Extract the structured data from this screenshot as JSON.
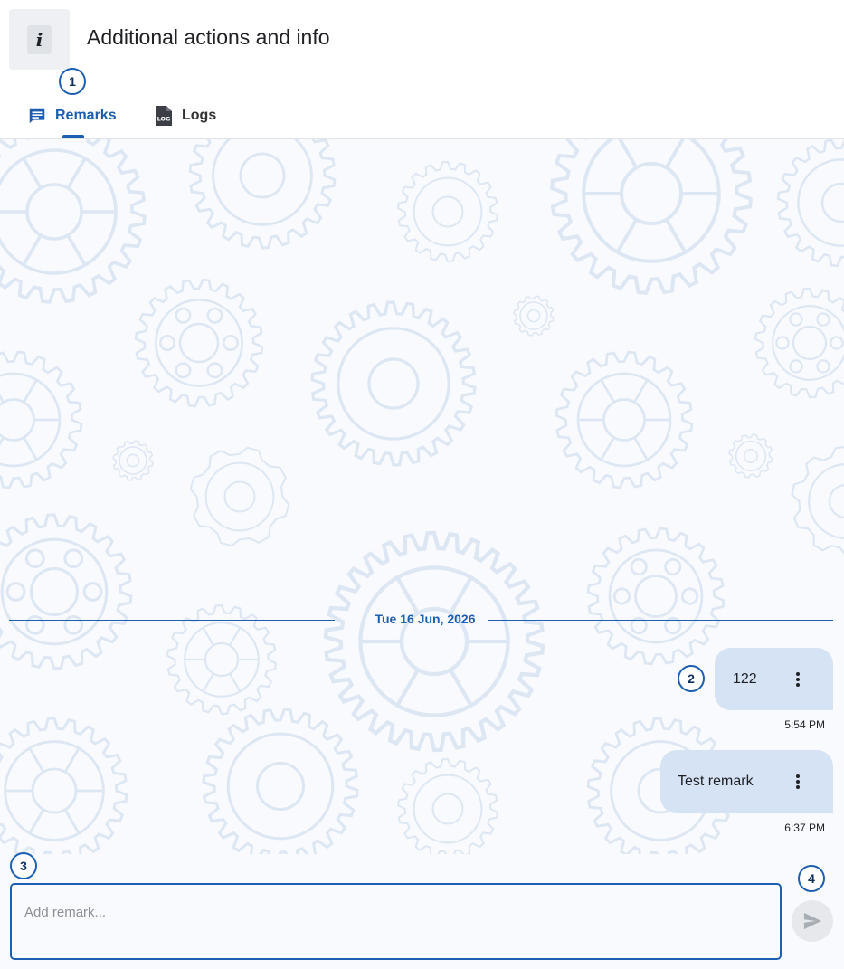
{
  "header": {
    "info_icon": "i",
    "title": "Additional actions and info"
  },
  "tabs": [
    {
      "label": "Remarks",
      "icon": "comment-icon",
      "active": true
    },
    {
      "label": "Logs",
      "icon": "log-file-icon",
      "active": false
    }
  ],
  "callouts": [
    "1",
    "2",
    "3",
    "4"
  ],
  "chat": {
    "date_separator": "Tue 16 Jun, 2026",
    "messages": [
      {
        "text": "122",
        "time": "5:54 PM"
      },
      {
        "text": "Test remark",
        "time": "6:37 PM"
      }
    ]
  },
  "composer": {
    "placeholder": "Add remark...",
    "value": ""
  },
  "colors": {
    "accent": "#1c5fb0",
    "bubble": "#d6e3f4",
    "background": "#f8fafd",
    "gear_pattern": "#dde6f3"
  },
  "icons": [
    "info-icon",
    "comment-icon",
    "log-file-icon",
    "more-vert-icon",
    "send-icon",
    "gear-pattern"
  ]
}
